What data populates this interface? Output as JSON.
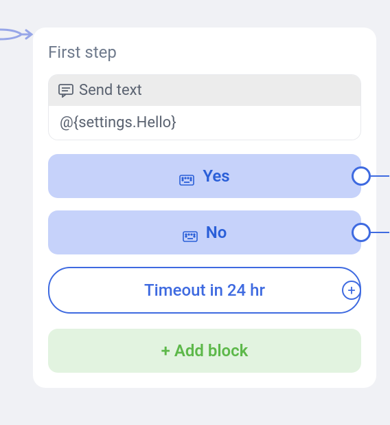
{
  "card": {
    "title": "First step",
    "sendText": {
      "headerLabel": "Send text",
      "value": "@{settings.Hello}"
    },
    "options": [
      {
        "label": "Yes"
      },
      {
        "label": "No"
      }
    ],
    "timeout": {
      "label": "Timeout in 24 hr"
    },
    "addBlock": {
      "label": "+ Add block"
    }
  }
}
